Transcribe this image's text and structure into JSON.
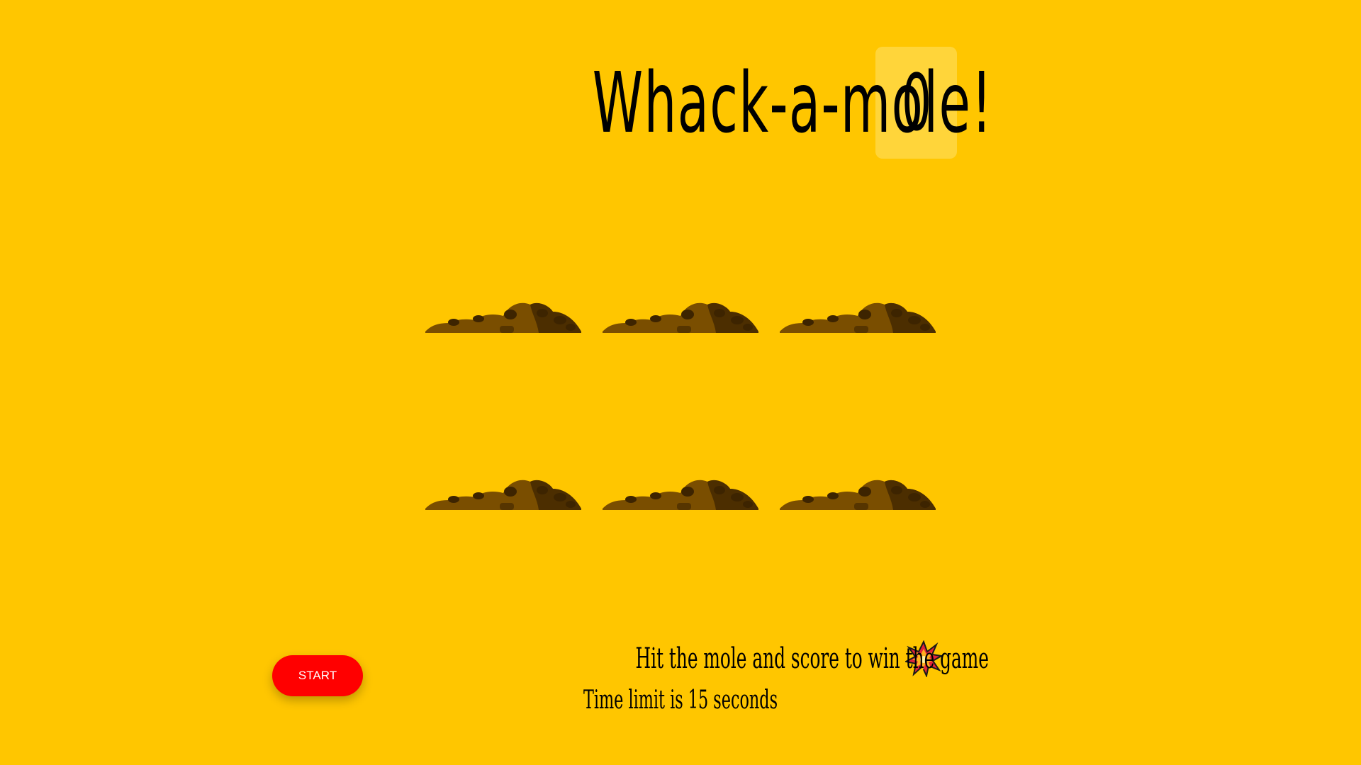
{
  "header": {
    "title": "Whack-a-mole!",
    "score": "0"
  },
  "board": {
    "holes": [
      {
        "label": "hole-1"
      },
      {
        "label": "hole-2"
      },
      {
        "label": "hole-3"
      },
      {
        "label": "hole-4"
      },
      {
        "label": "hole-5"
      },
      {
        "label": "hole-6"
      }
    ]
  },
  "controls": {
    "start_label": "START"
  },
  "instructions": {
    "line1": "Hit the mole and score to win the game",
    "line1_icon": "collision-icon",
    "line2": "Time limit is 15 seconds"
  },
  "colors": {
    "background": "#ffc600",
    "score_box": "#ffd53a",
    "start_button": "#ff0000",
    "dirt_light": "#7a4e00",
    "dirt_dark": "#3d2400"
  }
}
